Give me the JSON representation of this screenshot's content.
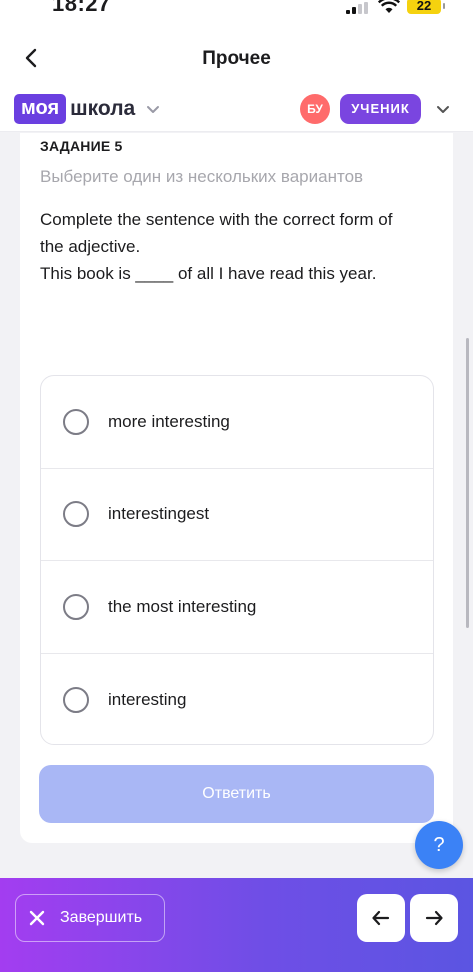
{
  "status": {
    "time": "18:27",
    "battery": "22"
  },
  "nav": {
    "title": "Прочее"
  },
  "brand": {
    "logo_box": "моя",
    "logo_text": "школа",
    "avatar_initials": "БУ",
    "role": "УЧЕНИК"
  },
  "task": {
    "number_label": "ЗАДАНИЕ 5",
    "hint": "Выберите один из нескольких вариантов",
    "question_lines": [
      "Complete the sentence with the correct form of",
      "the adjective.",
      "This book is ____ of all I have read this year."
    ],
    "options": [
      "more interesting",
      "interestingest",
      "the most interesting",
      "interesting"
    ],
    "answer_button": "Ответить"
  },
  "help_button": "?",
  "bottom": {
    "finish_label": "Завершить"
  },
  "colors": {
    "brand_purple": "#6a3fe0",
    "answer_button": "#a9b7f5",
    "avatar": "#ff6b6b",
    "help": "#3b82f6"
  }
}
